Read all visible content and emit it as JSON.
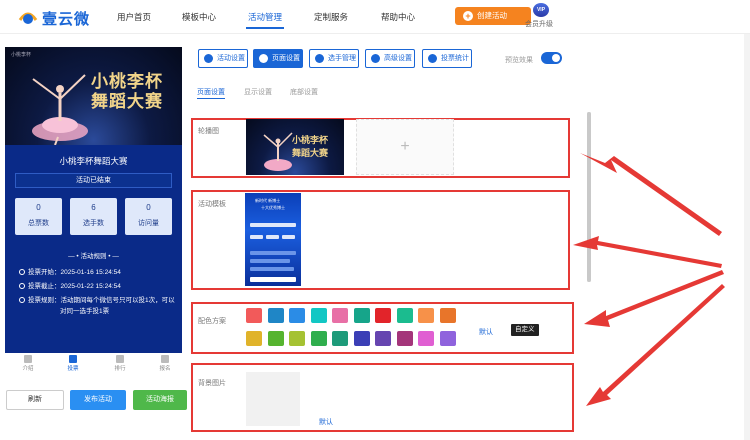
{
  "brand": {
    "name": "壹云微"
  },
  "nav": {
    "items": [
      {
        "label": "用户首页"
      },
      {
        "label": "模板中心"
      },
      {
        "label": "活动管理"
      },
      {
        "label": "定制服务"
      },
      {
        "label": "帮助中心"
      }
    ],
    "create_label": "创建活动",
    "vip_badge": "VIP",
    "vip_label": "会员升级"
  },
  "phone": {
    "banner_title_line1": "小桃李杯",
    "banner_title_line2": "舞蹈大赛",
    "banner_small": "小桃李杯",
    "activity_name": "小桃李杯舞蹈大赛",
    "status": "活动已结束",
    "stats": [
      {
        "value": "0",
        "label": "总票数"
      },
      {
        "value": "6",
        "label": "选手数"
      },
      {
        "value": "0",
        "label": "访问量"
      }
    ],
    "rules_title": "活动规则",
    "rules": [
      "投票开始：2025-01-16 15:24:54",
      "投票截止：2025-01-22 15:24:54",
      "投票规则：活动期间每个微信号只可以投1次，可以",
      "对同一选手投1票"
    ],
    "tabs": [
      {
        "label": "介绍",
        "icon": "home-icon"
      },
      {
        "label": "投票",
        "icon": "vote-icon"
      },
      {
        "label": "排行",
        "icon": "crown-icon"
      },
      {
        "label": "报名",
        "icon": "flag-icon"
      }
    ]
  },
  "actions": {
    "refresh": "刷新",
    "publish": "发布活动",
    "poster": "活动海报"
  },
  "toolbar": {
    "buttons": [
      {
        "label": "活动设置",
        "icon": "gear-icon"
      },
      {
        "label": "页面设置",
        "icon": "palette-icon"
      },
      {
        "label": "选手管理",
        "icon": "users-icon"
      },
      {
        "label": "高级设置",
        "icon": "settings-icon"
      },
      {
        "label": "投票统计",
        "icon": "bar-chart-icon"
      }
    ],
    "preview_label": "预览效果",
    "preview_on": true
  },
  "subtabs": [
    {
      "label": "页面设置"
    },
    {
      "label": "显示设置"
    },
    {
      "label": "底部设置"
    }
  ],
  "sections": {
    "carousel_label": "轮播图",
    "carousel_title_1": "小桃李杯",
    "carousel_title_2": "舞蹈大赛",
    "add_symbol": "+",
    "template_label": "活动模板",
    "template_text_1": "新时代 新博士",
    "template_text_2": "十大优秀博士",
    "color_label": "配色方案",
    "color_default": "默认",
    "color_custom": "自定义",
    "bg_label": "背景图片",
    "bg_default": "默认"
  },
  "colors": {
    "accent": "#1a66d6",
    "create_button": "#f5831f",
    "publish_button": "#2a8ff2",
    "poster_button": "#4fb84a",
    "highlight_border": "#e53935",
    "swatches_row1": [
      "#f25a5a",
      "#1f86c6",
      "#2b8ce6",
      "#12c7c4",
      "#e86fa6",
      "#16a58a",
      "#e2242a",
      "#1bbc8f",
      "#f79149",
      "#e8752a"
    ],
    "swatches_row2": [
      "#e0b32a",
      "#56b42f",
      "#a5c232",
      "#2fae4d",
      "#1d9b7a",
      "#3b3fb6",
      "#6645b0",
      "#a4357a",
      "#e05fd2",
      "#8f63dd"
    ]
  }
}
